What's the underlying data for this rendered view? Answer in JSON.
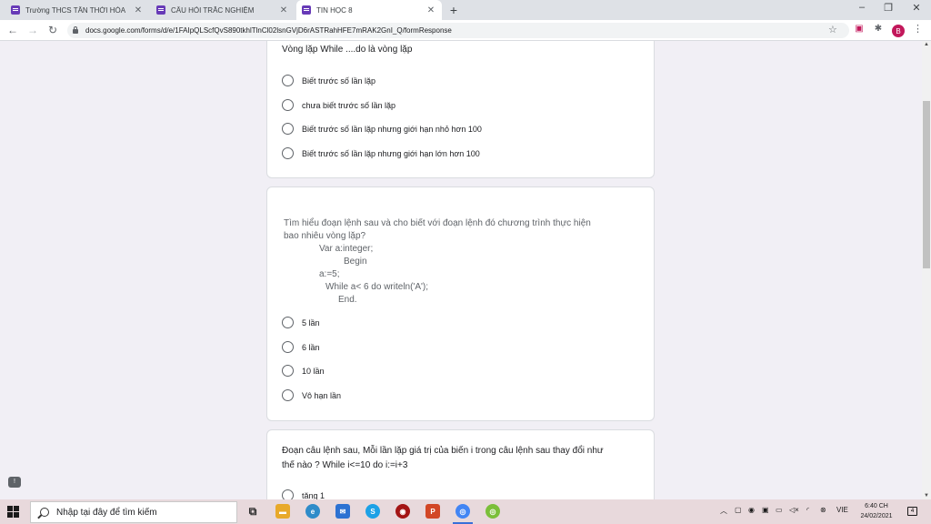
{
  "browser": {
    "tabs": [
      {
        "title": "Trường THCS TÂN THỚI HÒA",
        "close": "✕"
      },
      {
        "title": "CÂU HỎI TRẮC NGHIỆM",
        "close": "✕"
      },
      {
        "title": "TIN HỌC 8",
        "close": "✕"
      }
    ],
    "new_tab": "+",
    "window_controls": {
      "minimize": "–",
      "restore": "❐",
      "close": "✕"
    },
    "nav": {
      "back": "←",
      "forward": "→",
      "reload": "↻"
    },
    "url": "docs.google.com/forms/d/e/1FAIpQLScfQvS890tkhlTlnCl02lsnGVjD6rASTRahHFE7mRAK2GnI_Q/formResponse",
    "star": "☆",
    "extensions": [
      "▣",
      "✱"
    ],
    "avatar": "B",
    "menu": "⋮"
  },
  "form": {
    "q1": {
      "title": "Vòng lặp While ....do là vòng lặp",
      "options": [
        "Biết trước số lần lặp",
        "chưa biết trước số lần lặp",
        "Biết trước số lần lặp nhưng giới hạn nhỏ hơn 100",
        "Biết trước số lần lặp nhưng giới hạn lớn hơn 100"
      ]
    },
    "q2": {
      "title_line1": "Tìm hiểu đoạn lệnh sau và cho biết với đoạn lệnh đó chương trình thực hiện",
      "title_line2": "bao nhiêu vòng lặp?",
      "code": [
        "Var a:integer;",
        "Begin",
        "a:=5;",
        "While a< 6 do writeln('A');",
        "End."
      ],
      "options": [
        "5 lần",
        "6 lần",
        "10 lần",
        "Vô hạn lần"
      ]
    },
    "q3": {
      "title_line1": "Đoạn câu lệnh sau, Mỗi lần lặp giá trị của biến i trong câu lệnh sau thay đổi như",
      "title_line2": "thế nào ? While i<=10 do i:=i+3",
      "options": [
        "tăng 1"
      ]
    }
  },
  "feedback_icon": "!",
  "taskbar": {
    "search_placeholder": "Nhập tại đây để tìm kiếm",
    "language": "VIE",
    "time": "6:40 CH",
    "date": "24/02/2021",
    "notification_count": "4",
    "apps": [
      {
        "name": "task-view",
        "color": "#2b2b2b",
        "glyph": "⧉"
      },
      {
        "name": "file-explorer",
        "color": "#e8a92a",
        "glyph": "▬"
      },
      {
        "name": "edge",
        "color": "#2f8cc9",
        "glyph": "e"
      },
      {
        "name": "mail",
        "color": "#2d72d2",
        "glyph": "✉"
      },
      {
        "name": "skype",
        "color": "#1da1e6",
        "glyph": "S"
      },
      {
        "name": "app-red",
        "color": "#a31515",
        "glyph": "◉"
      },
      {
        "name": "powerpoint",
        "color": "#d24726",
        "glyph": "P"
      },
      {
        "name": "chrome",
        "color": "#4285f4",
        "glyph": "◎"
      },
      {
        "name": "chrome-canary",
        "color": "#7bbf3a",
        "glyph": "◎"
      }
    ]
  }
}
